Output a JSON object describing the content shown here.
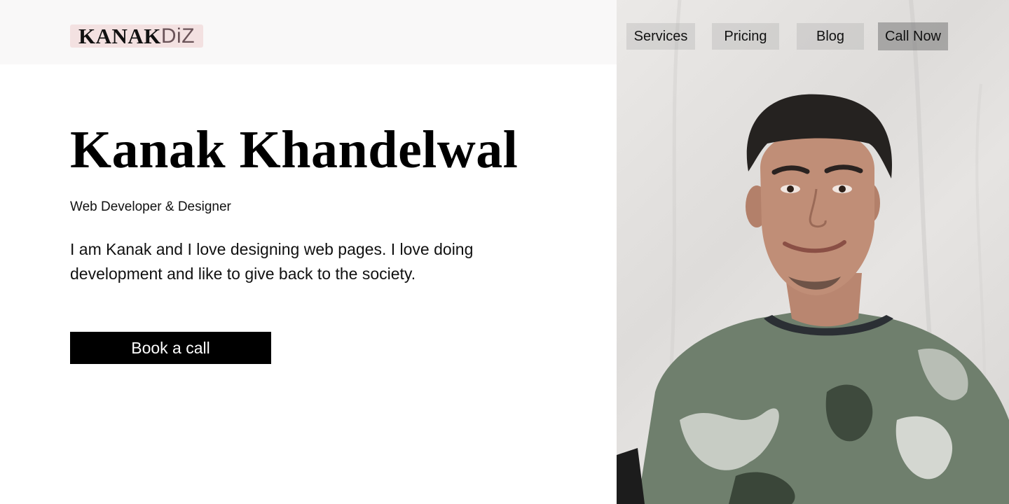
{
  "brand": {
    "logo_strong": "KANAK",
    "logo_light": "DiZ"
  },
  "nav": {
    "items": [
      {
        "label": "Services"
      },
      {
        "label": "Pricing"
      },
      {
        "label": "Blog"
      },
      {
        "label": "Call Now"
      }
    ]
  },
  "hero": {
    "name": "Kanak Khandelwal",
    "subtitle": "Web Developer & Designer",
    "intro": "I am Kanak and I love designing web pages. I love doing development and like to give back to the society.",
    "cta_label": "Book a call"
  },
  "colors": {
    "header_bg": "#f9f8f8",
    "logo_bg": "#f3e1e1",
    "cta_bg": "#000000",
    "cta_text": "#ffffff"
  }
}
